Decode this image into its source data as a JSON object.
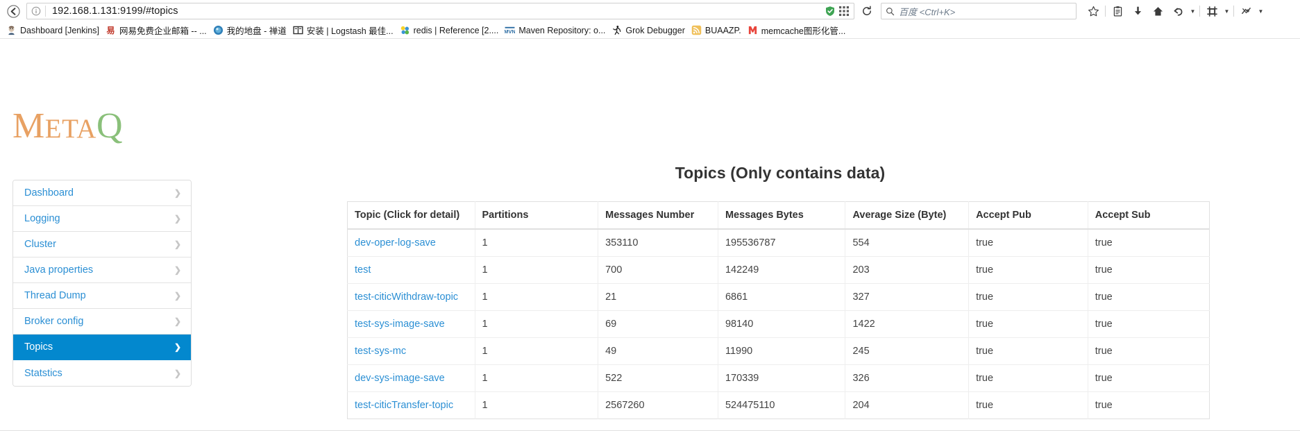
{
  "browser": {
    "back_label": "back-arrow",
    "url": "192.168.1.131:9199/#topics",
    "url_host": "192.168.1.131",
    "url_rest": ":9199/#topics",
    "search_placeholder": "百度 <Ctrl+K>",
    "toolbar_icons": [
      "bookmark-star-icon",
      "reading-list-icon",
      "downloads-icon",
      "home-icon",
      "undo-icon",
      "undo-dropdown-icon",
      "screenshot-icon",
      "screenshot-dropdown-icon",
      "extension-icon",
      "extension-dropdown-icon"
    ],
    "shield_icon": "shield-icon",
    "pixel_icon": "pixel-block-icon",
    "reload_icon": "reload-icon",
    "identity_icon": "info-icon",
    "search_icon": "search-icon"
  },
  "bookmarks": [
    {
      "label": "Dashboard [Jenkins]",
      "icon": "jenkins-icon"
    },
    {
      "label": "网易免费企业邮箱 -- ...",
      "icon": "netease-icon"
    },
    {
      "label": "我的地盘 - 禅道",
      "icon": "zentao-icon"
    },
    {
      "label": "安装 | Logstash 最佳...",
      "icon": "book-icon"
    },
    {
      "label": "redis | Reference [2....",
      "icon": "redis-icon"
    },
    {
      "label": "Maven Repository: o...",
      "icon": "maven-icon"
    },
    {
      "label": "Grok Debugger",
      "icon": "grok-icon"
    },
    {
      "label": "BUAAZP.",
      "icon": "rss-icon"
    },
    {
      "label": "memcache图形化管...",
      "icon": "memcache-icon"
    }
  ],
  "app": {
    "logo_m": "M",
    "logo_eta": "ETA",
    "logo_q": "Q",
    "accent_color": "#0388ce",
    "link_color": "#2b8fd4"
  },
  "sidebar": {
    "items": [
      {
        "label": "Dashboard",
        "active": false,
        "chevron": "chevron-right-icon"
      },
      {
        "label": "Logging",
        "active": false,
        "chevron": "chevron-right-icon"
      },
      {
        "label": "Cluster",
        "active": false,
        "chevron": "chevron-right-icon"
      },
      {
        "label": "Java properties",
        "active": false,
        "chevron": "chevron-right-icon"
      },
      {
        "label": "Thread Dump",
        "active": false,
        "chevron": "chevron-right-icon"
      },
      {
        "label": "Broker config",
        "active": false,
        "chevron": "chevron-right-icon"
      },
      {
        "label": "Topics",
        "active": true,
        "chevron": "chevron-right-icon"
      },
      {
        "label": "Statstics",
        "active": false,
        "chevron": "chevron-right-icon"
      }
    ]
  },
  "main": {
    "title": "Topics (Only contains data)",
    "table": {
      "columns": [
        "Topic (Click for detail)",
        "Partitions",
        "Messages Number",
        "Messages Bytes",
        "Average Size (Byte)",
        "Accept Pub",
        "Accept Sub"
      ],
      "rows": [
        {
          "topic": "dev-oper-log-save",
          "partitions": "1",
          "messages_number": "353110",
          "messages_bytes": "195536787",
          "average_size": "554",
          "accept_pub": "true",
          "accept_sub": "true"
        },
        {
          "topic": "test",
          "partitions": "1",
          "messages_number": "700",
          "messages_bytes": "142249",
          "average_size": "203",
          "accept_pub": "true",
          "accept_sub": "true"
        },
        {
          "topic": "test-citicWithdraw-topic",
          "partitions": "1",
          "messages_number": "21",
          "messages_bytes": "6861",
          "average_size": "327",
          "accept_pub": "true",
          "accept_sub": "true"
        },
        {
          "topic": "test-sys-image-save",
          "partitions": "1",
          "messages_number": "69",
          "messages_bytes": "98140",
          "average_size": "1422",
          "accept_pub": "true",
          "accept_sub": "true"
        },
        {
          "topic": "test-sys-mc",
          "partitions": "1",
          "messages_number": "49",
          "messages_bytes": "11990",
          "average_size": "245",
          "accept_pub": "true",
          "accept_sub": "true"
        },
        {
          "topic": "dev-sys-image-save",
          "partitions": "1",
          "messages_number": "522",
          "messages_bytes": "170339",
          "average_size": "326",
          "accept_pub": "true",
          "accept_sub": "true"
        },
        {
          "topic": "test-citicTransfer-topic",
          "partitions": "1",
          "messages_number": "2567260",
          "messages_bytes": "524475110",
          "average_size": "204",
          "accept_pub": "true",
          "accept_sub": "true"
        }
      ]
    }
  }
}
